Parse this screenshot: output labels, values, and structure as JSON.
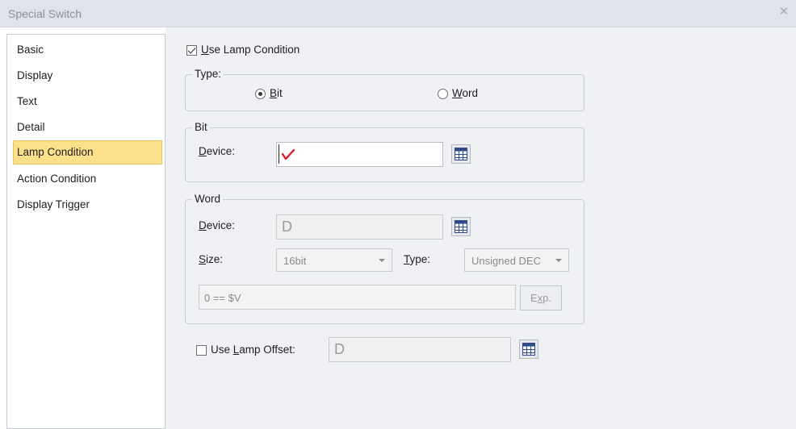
{
  "window": {
    "title": "Special Switch"
  },
  "nav": {
    "items": [
      {
        "label": "Basic"
      },
      {
        "label": "Display"
      },
      {
        "label": "Text"
      },
      {
        "label": "Detail"
      },
      {
        "label": "Lamp Condition"
      },
      {
        "label": "Action Condition"
      },
      {
        "label": "Display Trigger"
      }
    ],
    "active": "Lamp Condition"
  },
  "lamp": {
    "use_condition": {
      "label_key": "U",
      "label_rest": "se Lamp Condition",
      "checked": true
    },
    "type_group": {
      "title": "Type:",
      "bit": {
        "key": "B",
        "rest": "it",
        "selected": true
      },
      "word": {
        "key": "W",
        "rest": "ord",
        "selected": false
      }
    },
    "bit_group": {
      "title": "Bit",
      "device_label_key": "D",
      "device_label_rest": "evice:",
      "device_value": ""
    },
    "word_group": {
      "title": "Word",
      "device_label_key": "D",
      "device_label_rest": "evice:",
      "device_value": "D",
      "size_label_key": "S",
      "size_label_rest": "ize:",
      "size_value": "16bit",
      "type_label_key": "T",
      "type_label_rest": "ype:",
      "type_value": "Unsigned DEC",
      "expression": "0 == $V",
      "exp_button_key": "x",
      "exp_button_pre": "E",
      "exp_button_post": "p."
    },
    "offset": {
      "label_pre": "Use ",
      "label_key": "L",
      "label_rest": "amp Offset:",
      "checked": false,
      "value": "D"
    }
  },
  "colors": {
    "active_nav": "#fde08a",
    "panel_bg": "#f0f1f5",
    "titlebar_bg": "#dfe3ea",
    "error_mark": "#e0141e"
  }
}
